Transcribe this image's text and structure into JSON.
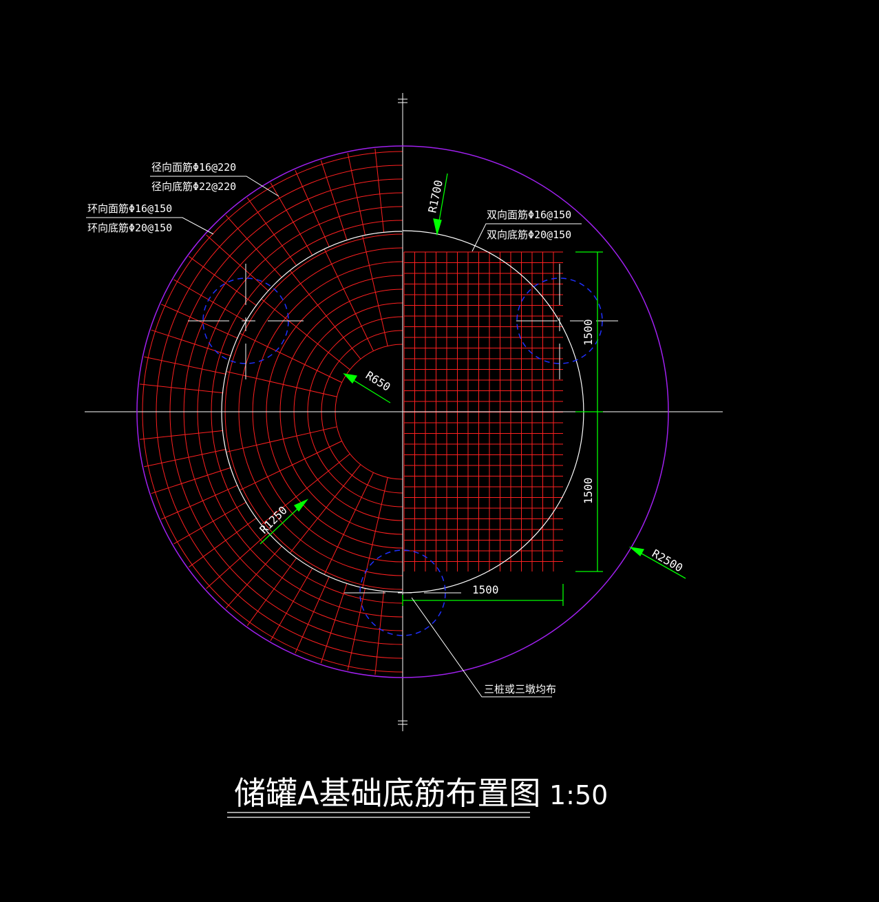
{
  "drawing": {
    "title": "储罐A基础底筋布置图",
    "scale": "1:50",
    "colors": {
      "background": "#000000",
      "rebar": "#ff2020",
      "outline": "#a020f0",
      "dimension": "#00ff00",
      "pile": "#0000ff",
      "centerline": "#ffffff",
      "text": "#ffffff"
    },
    "radii_labels": {
      "r650": "R650",
      "r1250": "R1250",
      "r1700": "R1700",
      "r2500": "R2500"
    },
    "rebar_notes": {
      "radial_top": "径向面筋Φ16@220",
      "radial_bottom": "径向底筋Φ22@220",
      "ring_top": "环向面筋Φ16@150",
      "ring_bottom": "环向底筋Φ20@150",
      "twoway_top": "双向面筋Φ16@150",
      "twoway_bottom": "双向底筋Φ20@150",
      "piles": "三桩或三墩均布"
    },
    "dimensions": {
      "upper_vertical": "1500",
      "lower_vertical": "1500",
      "horizontal": "1500"
    }
  }
}
